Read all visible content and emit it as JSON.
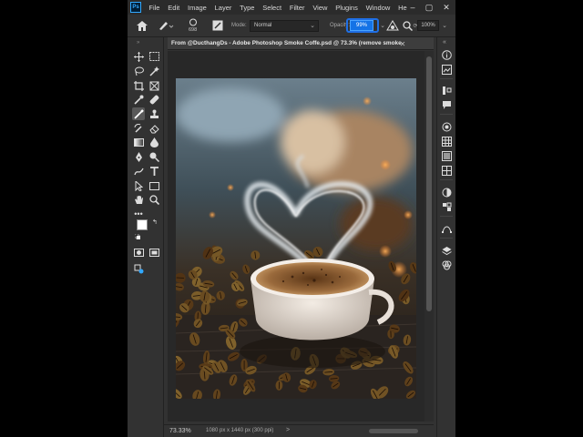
{
  "app": {
    "logo": "Ps"
  },
  "menu": {
    "items": [
      "File",
      "Edit",
      "Image",
      "Layer",
      "Type",
      "Select",
      "Filter",
      "View",
      "Plugins",
      "Window",
      "He"
    ]
  },
  "options_bar": {
    "brush_size": "698",
    "mode_label": "Mode:",
    "mode_value": "Normal",
    "opacity_label": "Opacity:",
    "opacity_value": "99%",
    "zoom_value": "100%"
  },
  "document": {
    "tab_title": "From @DucthangDs - Adobe Photoshop Smoke Coffe.psd @ 73.3% (remove smoke"
  },
  "status": {
    "zoom": "73.33%",
    "info": "1080 px x 1440 px (300 ppi)",
    "arrow": ">"
  },
  "colors": {
    "accent": "#1473e6",
    "foreground": "#ffffff",
    "background": "#000000"
  }
}
